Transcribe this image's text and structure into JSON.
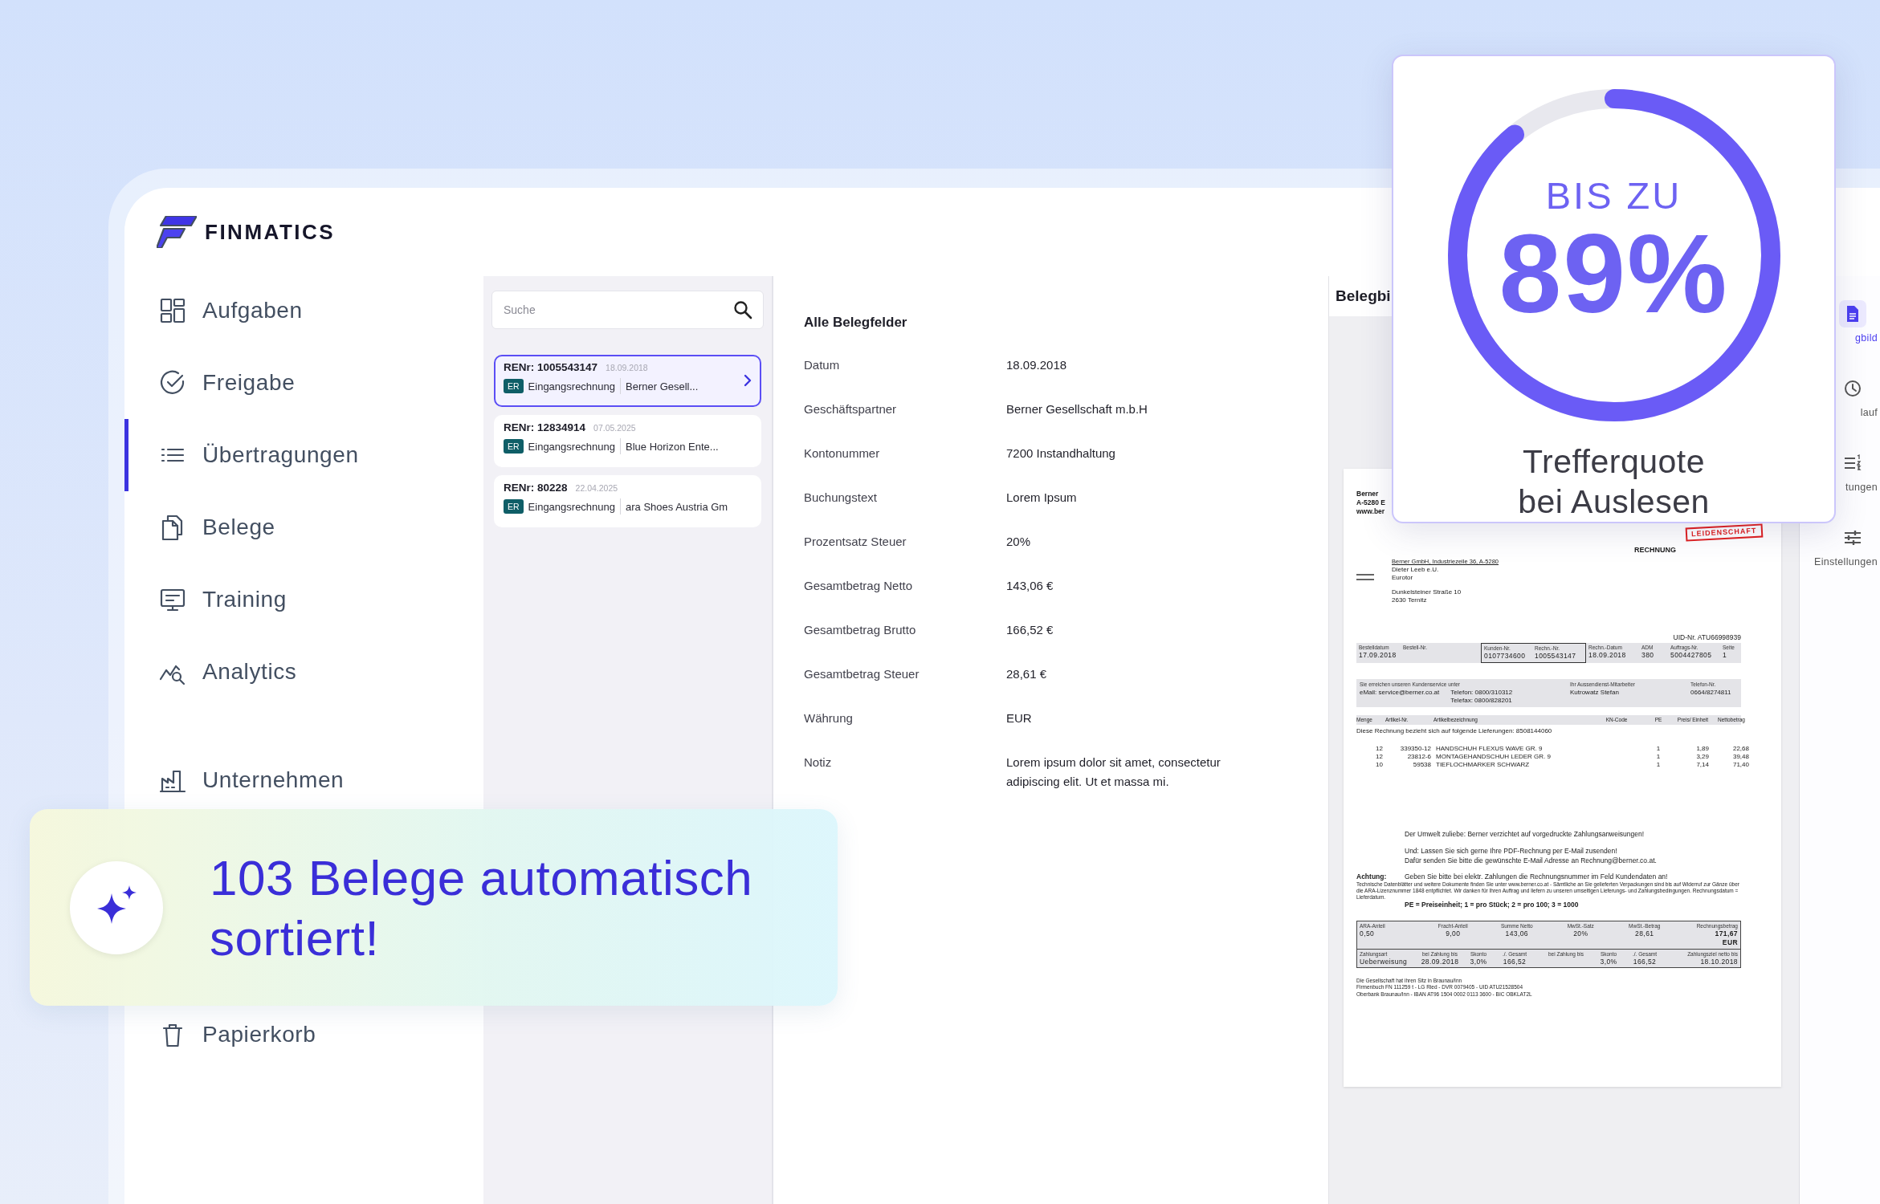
{
  "brand": {
    "name": "FINMATICS"
  },
  "nav": [
    {
      "label": "Aufgaben",
      "selected": false
    },
    {
      "label": "Freigabe",
      "selected": false
    },
    {
      "label": "Übertragungen",
      "selected": true
    },
    {
      "label": "Belege",
      "selected": false
    },
    {
      "label": "Training",
      "selected": false
    },
    {
      "label": "Analytics",
      "selected": false
    },
    {
      "label": "Unternehmen",
      "selected": false
    },
    {
      "label": "Papierkorb",
      "selected": false
    }
  ],
  "search": {
    "placeholder": "Suche"
  },
  "documents": [
    {
      "number": "RENr: 1005543147",
      "date": "18.09.2018",
      "badge": "ER",
      "type": "Eingangsrechnung",
      "partner": "Berner Gesell...",
      "selected": true
    },
    {
      "number": "RENr: 12834914",
      "date": "07.05.2025",
      "badge": "ER",
      "type": "Eingangsrechnung",
      "partner": "Blue Horizon Ente...",
      "selected": false
    },
    {
      "number": "RENr: 80228",
      "date": "22.04.2025",
      "badge": "ER",
      "type": "Eingangsrechnung",
      "partner": "ara Shoes Austria Gm",
      "selected": false
    }
  ],
  "fields": {
    "title": "Alle Belegfelder",
    "rows": [
      {
        "label": "Datum",
        "value": "18.09.2018"
      },
      {
        "label": "Geschäftspartner",
        "value": "Berner Gesellschaft m.b.H"
      },
      {
        "label": "Kontonummer",
        "value": "7200 Instandhaltung"
      },
      {
        "label": "Buchungstext",
        "value": "Lorem Ipsum"
      },
      {
        "label": "Prozentsatz Steuer",
        "value": "20%"
      },
      {
        "label": "Gesamtbetrag Netto",
        "value": "143,06 €"
      },
      {
        "label": "Gesamtbetrag Brutto",
        "value": "166,52 €"
      },
      {
        "label": "Gesamtbetrag Steuer",
        "value": "28,61 €"
      },
      {
        "label": "Währung",
        "value": "EUR"
      },
      {
        "label": "Notiz",
        "value": "Lorem ipsum dolor sit amet, consectetur adipiscing elit. Ut et massa mi."
      }
    ]
  },
  "viewer": {
    "title": "Belegbi",
    "invoice": {
      "letterhead": [
        "Berner",
        "A-5280 E",
        "www.ber"
      ],
      "stamp": "LEIDENSCHAFT",
      "title": "RECHNUNG",
      "sender_line": "Berner GmbH, Industriezeile 36, A-5280",
      "recipient": [
        "Dieter Leeb e.U.",
        "Eurotor"
      ],
      "street": [
        "Dunkelsteiner Straße 10",
        "2630 Ternitz"
      ],
      "uid": "UID-Nr. ATU66998939",
      "order_info": {
        "before": [
          {
            "label": "Bestelldatum",
            "value": "17.09.2018"
          },
          {
            "label": "Bestell-Nr."
          }
        ],
        "boxed": [
          {
            "label": "Kunden-Nr.",
            "value": "0107734600"
          },
          {
            "label": "Rechn.-Nr.",
            "value": "1005543147"
          }
        ],
        "after": [
          {
            "label": "Rechn.-Datum",
            "value": "18.09.2018"
          },
          {
            "label": "ADM",
            "value": "380"
          },
          {
            "label": "Auftrags-Nr.",
            "value": "5004427805"
          },
          {
            "label": "Seite",
            "value": "1"
          }
        ]
      },
      "contact": {
        "intro": "Sie erreichen unseren Kundenservice unter",
        "email": "eMail: service@berner.co.at",
        "phone": "Telefon: 0800/310312",
        "fax": "Telefax: 0800/828201",
        "rep_label": "Ihr Aussendienst-Mitarbeiter",
        "rep": "Kutrowatz Stefan",
        "rep_phone_label": "Telefon-Nr.",
        "rep_phone": "0664/8274811"
      },
      "item_columns": [
        "Menge",
        "Artikel-Nr.",
        "Artikelbezeichnung",
        "KN-Code",
        "PE",
        "Preis/ Einheit",
        "Nettobetrag"
      ],
      "delivery_note": "Diese Rechnung bezieht sich auf folgende Lieferungen: 8508144060",
      "items": [
        {
          "qty": "12",
          "article": "339350-12",
          "name": "HANDSCHUH FLEXUS WAVE GR. 9",
          "pe": "1",
          "price": "1,89",
          "net": "22,68"
        },
        {
          "qty": "12",
          "article": "23812-6",
          "name": "MONTAGEHANDSCHUH LEDER GR. 9",
          "pe": "1",
          "price": "3,29",
          "net": "39,48"
        },
        {
          "qty": "10",
          "article": "59538",
          "name": "TIEFLOCHMARKER SCHWARZ",
          "pe": "1",
          "price": "7,14",
          "net": "71,40"
        }
      ],
      "notes": [
        "Der Umwelt zuliebe: Berner verzichtet auf vorgedruckte Zahlungsanweisungen!",
        "Und: Lassen Sie sich gerne Ihre PDF-Rechnung per E-Mail zusenden!",
        "Dafür senden Sie bitte die gewünschte E-Mail Adresse an Rechnung@berner.co.at."
      ],
      "attention": {
        "label": "Achtung:",
        "text": "Geben Sie bitte bei elektr. Zahlungen die Rechnungsnummer im Feld Kundendaten an!"
      },
      "fine_print": "Technische Datenblätter und weitere Dokumente finden Sie unter www.berner.co.at - Sämtliche an Sie gelieferten Verpackungen sind bis auf Widerruf zur Gänze über die ARA-Lizenznummer 1848 entpflichtet. Wir danken für Ihren Auftrag und liefern zu unseren umseitigen Lieferungs- und Zahlungsbedingungen. Rechnungsdatum = Lieferdatum.",
      "pe_legend": "PE = Preiseinheit; 1 = pro Stück; 2 = pro 100; 3 = 1000",
      "totals": [
        {
          "label": "ARA-Anteil",
          "value": "0,50"
        },
        {
          "label": "Fracht-Anteil",
          "value": "9,00"
        },
        {
          "label": "Summe Netto",
          "value": "143,06"
        },
        {
          "label": "MwSt.-Satz",
          "value": "20%"
        },
        {
          "label": "MwSt.-Betrag",
          "value": "28,61"
        },
        {
          "label": "Rechnungsbetrag",
          "value": "171,67 EUR"
        }
      ],
      "payment": [
        {
          "label": "Zahlungsart",
          "value": "Ueberweisung"
        },
        {
          "label": "bei Zahlung bis",
          "value": "28.09.2018"
        },
        {
          "label": "Skonto",
          "value": "3,0%"
        },
        {
          "label": "./. Gesamt",
          "value": "166,52"
        },
        {
          "label": "bei Zahlung bis"
        },
        {
          "label": "Skonto",
          "value": "3,0%"
        },
        {
          "label": "./. Gesamt",
          "value": "166,52"
        },
        {
          "label": "Zahlungsziel netto bis",
          "value": "18.10.2018"
        }
      ],
      "footer": [
        "Die Gesellschaft hat ihren Sitz in Braunau/Inn",
        "Firmenbuch FN 111259 t  -  LG Ried  -  DVR 0079405  -  UID ATU21528504",
        "Oberbank Braunau/Inn  -  IBAN AT96 1504 0002 0113 3600  -  BIC OBKLAT2L"
      ]
    }
  },
  "rail": [
    {
      "label": "gbild",
      "selected": true
    },
    {
      "label": "lauf",
      "selected": false
    },
    {
      "label": "tungen",
      "selected": false
    },
    {
      "label": "Einstellungen",
      "selected": false
    }
  ],
  "stat": {
    "prefix": "BIS ZU",
    "value": "89%",
    "caption": "Trefferquote bei Auslesen"
  },
  "toast": {
    "message": "103 Belege automatisch sortiert!"
  }
}
